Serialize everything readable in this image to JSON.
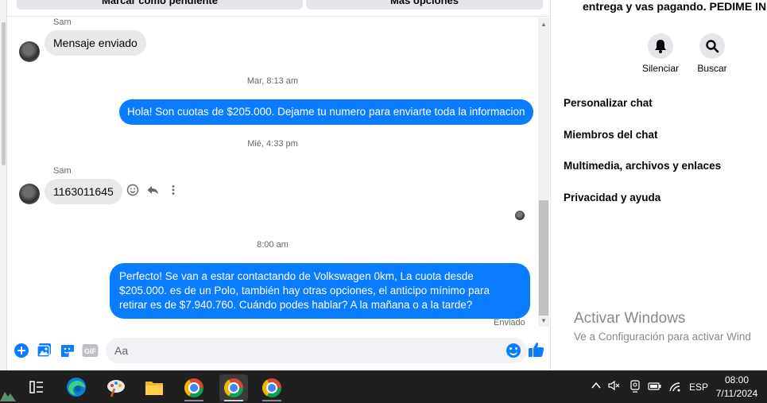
{
  "top_actions": {
    "mark_pending": "Marcar como pendiente",
    "more_options": "Más opciones"
  },
  "conversation": {
    "messages": [
      {
        "sender": "Sam",
        "text": "Mensaje enviado"
      },
      {
        "timestamp": "Mar, 8:13 am"
      },
      {
        "text": "Hola! Son cuotas de $205.000. Dejame tu numero para enviarte toda la informacion"
      },
      {
        "timestamp": "Mié, 4:33 pm"
      },
      {
        "sender": "Sam",
        "text": "1163011645"
      },
      {
        "timestamp": "8:00 am"
      },
      {
        "text": "Perfecto!  Se van a estar contactando de Volkswagen 0km, La cuota desde $205.000. es de un Polo, también hay otras opciones, el anticipo mínimo para retirar es de $7.940.760. Cuándo podes hablar? A la mañana o a la tarde?",
        "status": "Enviado"
      }
    ]
  },
  "composer": {
    "placeholder": "Aa",
    "gif_label": "GIF"
  },
  "right_panel": {
    "header_text": "entrega y vas pagando. PEDIME IN",
    "actions": [
      {
        "label": "Silenciar",
        "icon": "bell-icon"
      },
      {
        "label": "Buscar",
        "icon": "search-icon"
      }
    ],
    "menu_items": [
      "Personalizar chat",
      "Miembros del chat",
      "Multimedia, archivos y enlaces",
      "Privacidad y ayuda"
    ]
  },
  "watermark": {
    "title": "Activar Windows",
    "subtitle": "Ve a Configuración para activar Wind"
  },
  "taskbar": {
    "language": "ESP",
    "time": "08:00",
    "date": "7/11/2024"
  },
  "colors": {
    "accent": "#0a7cff",
    "incoming_bubble": "#e9e9eb",
    "taskbar": "#1f1f1f"
  }
}
